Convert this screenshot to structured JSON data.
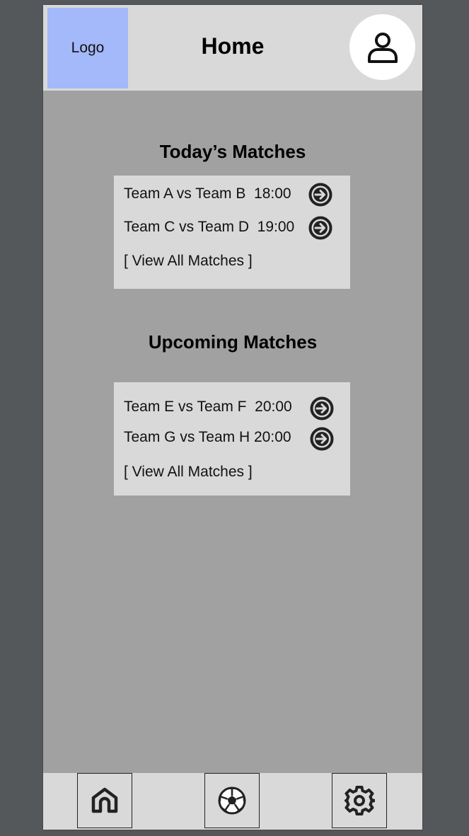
{
  "header": {
    "logo_label": "Logo",
    "title": "Home",
    "profile_icon": "user-icon"
  },
  "today": {
    "title": "Today’s Matches",
    "matches": [
      {
        "label": "Team A vs Team B  18:00",
        "icon": "arrow-right-circle-icon"
      },
      {
        "label": "Team C vs Team D  19:00",
        "icon": "arrow-right-circle-icon"
      }
    ],
    "view_all": "[ View All Matches ]"
  },
  "upcoming": {
    "title": "Upcoming Matches",
    "matches": [
      {
        "label": "Team E vs Team F  20:00",
        "icon": "arrow-right-circle-icon"
      },
      {
        "label": "Team G vs Team H 20:00",
        "icon": "arrow-right-circle-icon"
      }
    ],
    "view_all": "[ View All Matches ]"
  },
  "navbar": {
    "items": [
      {
        "icon": "home-icon"
      },
      {
        "icon": "soccer-ball-icon"
      },
      {
        "icon": "gear-icon"
      }
    ]
  },
  "colors": {
    "background": "#54585b",
    "screen": "#a1a1a1",
    "panel": "#d9d9d9",
    "logo": "#a4b9f9"
  }
}
